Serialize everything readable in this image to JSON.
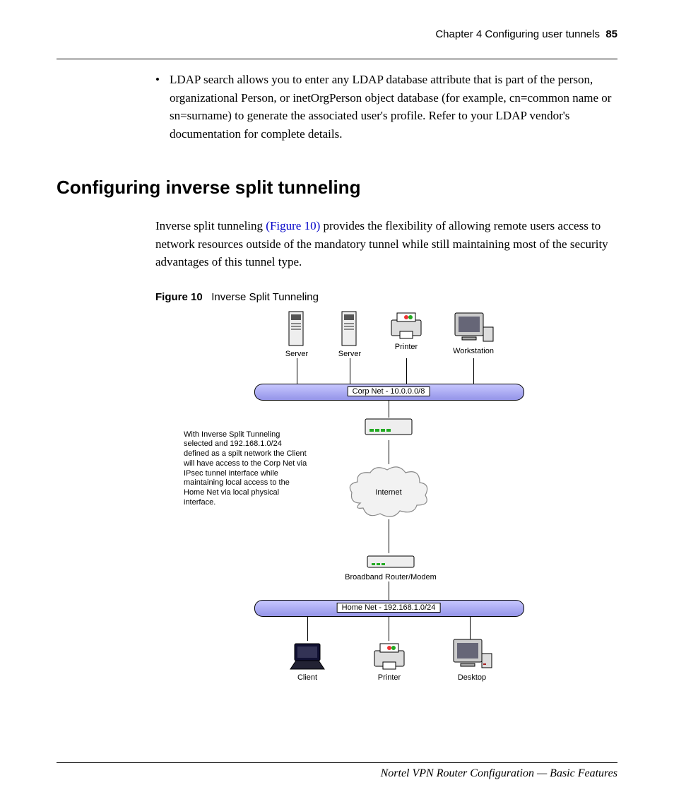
{
  "header": {
    "chapter": "Chapter 4  Configuring user tunnels",
    "page": "85"
  },
  "bullet": {
    "text": "LDAP search allows you to enter any LDAP database attribute that is part of the person, organizational Person, or inetOrgPerson object database (for example, cn=common name or sn=surname) to generate the associated user's profile. Refer to your LDAP vendor's documentation for complete details."
  },
  "section_title": "Configuring inverse split tunneling",
  "intro": {
    "pre": "Inverse split tunneling ",
    "link": "(Figure 10)",
    "post": " provides the flexibility of allowing remote users access to network resources outside of the mandatory tunnel while still maintaining most of the security advantages of this tunnel type."
  },
  "figure": {
    "label": "Figure 10",
    "title": "Inverse Split Tunneling",
    "annotation": "With Inverse Split Tunneling selected and 192.168.1.0/24 defined as a spilt network the Client will have access to the Corp Net via IPsec tunnel interface while maintaining local access to the Home Net via local physical interface.",
    "top_devices": {
      "server1": "Server",
      "server2": "Server",
      "printer": "Printer",
      "workstation": "Workstation"
    },
    "corp_net": "Corp Net - 10.0.0.0/8",
    "internet": "Internet",
    "broadband": "Broadband Router/Modem",
    "home_net": "Home Net - 192.168.1.0/24",
    "bottom_devices": {
      "client": "Client",
      "printer": "Printer",
      "desktop": "Desktop"
    }
  },
  "footer": "Nortel VPN Router Configuration — Basic Features"
}
